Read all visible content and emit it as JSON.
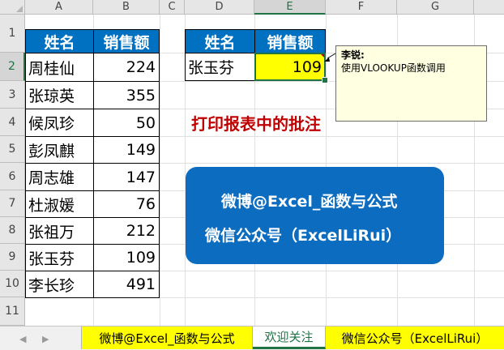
{
  "columns": [
    "A",
    "B",
    "C",
    "D",
    "E",
    "F",
    "G"
  ],
  "rows": [
    "1",
    "2",
    "3",
    "4",
    "5",
    "6",
    "7",
    "8",
    "9",
    "10",
    "11"
  ],
  "main_table": {
    "headers": [
      "姓名",
      "销售额"
    ],
    "rows": [
      [
        "周桂仙",
        "224"
      ],
      [
        "张琼英",
        "355"
      ],
      [
        "候凤珍",
        "50"
      ],
      [
        "彭凤麒",
        "149"
      ],
      [
        "周志雄",
        "147"
      ],
      [
        "杜淑媛",
        "76"
      ],
      [
        "张祖万",
        "212"
      ],
      [
        "张玉芬",
        "109"
      ],
      [
        "李长珍",
        "491"
      ]
    ]
  },
  "lookup_table": {
    "headers": [
      "姓名",
      "销售额"
    ],
    "name": "张玉芬",
    "value": "109"
  },
  "comment": {
    "author": "李锐:",
    "text": "使用VLOOKUP函数调用"
  },
  "title_red": "打印报表中的批注",
  "info_box": {
    "line1": "微博@Excel_函数与公式",
    "line2": "微信公众号（ExcelLiRui）"
  },
  "sheet_tabs": [
    {
      "label": "微博@Excel_函数与公式",
      "style": "yellow"
    },
    {
      "label": "欢迎关注",
      "style": "active"
    },
    {
      "label": "微信公众号（ExcelLiRui）",
      "style": "yellow"
    }
  ],
  "colors": {
    "header_blue": "#0070c0",
    "highlight_yellow": "#ffff00",
    "title_red": "#c00000",
    "excel_green": "#217346",
    "info_blue": "#0b6cc0"
  }
}
